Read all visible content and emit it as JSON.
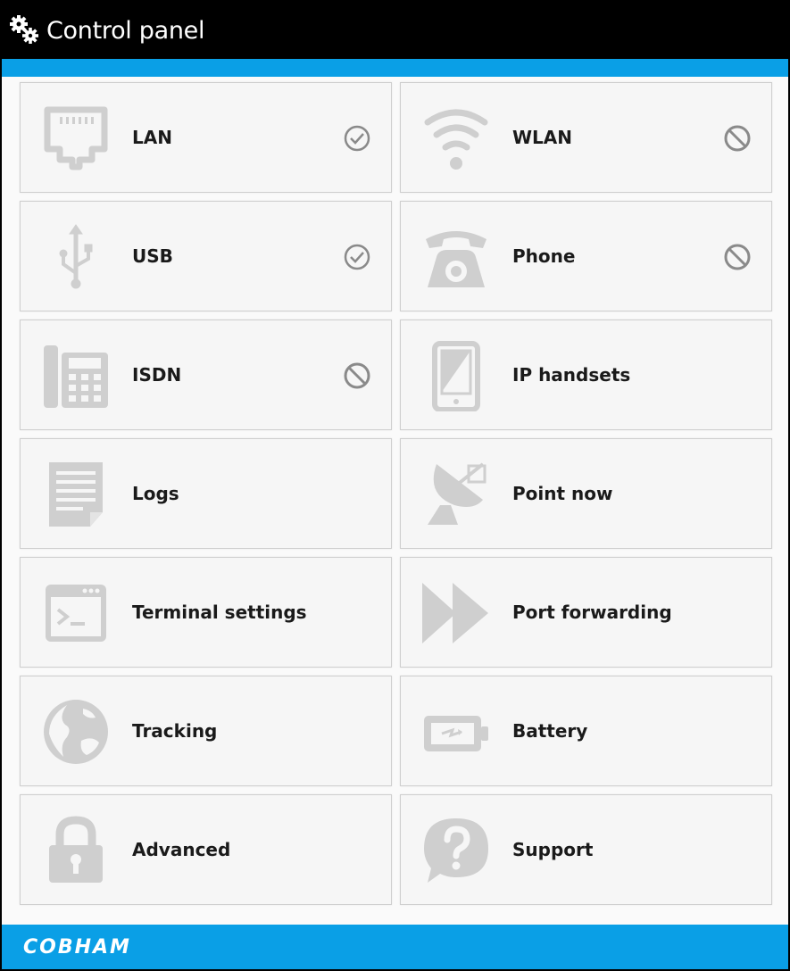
{
  "window": {
    "title": "Control panel"
  },
  "footer": {
    "brand": "COBHAM"
  },
  "colors": {
    "header": "#000000",
    "accent": "#0a9fe6",
    "tile_bg": "#f6f6f6",
    "icon": "#cfcfcf"
  },
  "tiles": [
    {
      "label": "LAN",
      "icon": "ethernet-port-icon",
      "status": "check-circle-icon"
    },
    {
      "label": "WLAN",
      "icon": "wifi-icon",
      "status": "disabled-circle-icon"
    },
    {
      "label": "USB",
      "icon": "usb-icon",
      "status": "check-circle-icon"
    },
    {
      "label": "Phone",
      "icon": "telephone-icon",
      "status": "disabled-circle-icon"
    },
    {
      "label": "ISDN",
      "icon": "desk-phone-icon",
      "status": "disabled-circle-icon"
    },
    {
      "label": "IP handsets",
      "icon": "handset-device-icon",
      "status": ""
    },
    {
      "label": "Logs",
      "icon": "document-icon",
      "status": ""
    },
    {
      "label": "Point now",
      "icon": "satellite-dish-icon",
      "status": ""
    },
    {
      "label": "Terminal settings",
      "icon": "terminal-icon",
      "status": ""
    },
    {
      "label": "Port forwarding",
      "icon": "fast-forward-icon",
      "status": ""
    },
    {
      "label": "Tracking",
      "icon": "globe-icon",
      "status": ""
    },
    {
      "label": "Battery",
      "icon": "battery-icon",
      "status": ""
    },
    {
      "label": "Advanced",
      "icon": "padlock-icon",
      "status": ""
    },
    {
      "label": "Support",
      "icon": "help-bubble-icon",
      "status": ""
    }
  ]
}
